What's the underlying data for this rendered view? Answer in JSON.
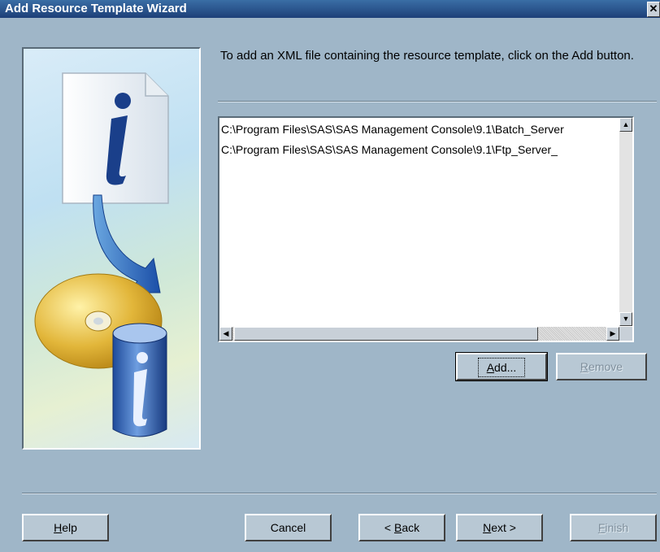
{
  "window": {
    "title": "Add Resource Template Wizard",
    "close_glyph": "✕"
  },
  "instruction": "To add an XML file containing the resource template, click on the Add button.",
  "files": [
    "C:\\Program Files\\SAS\\SAS Management Console\\9.1\\Batch_Server",
    "C:\\Program Files\\SAS\\SAS Management Console\\9.1\\Ftp_Server_"
  ],
  "buttons": {
    "add": {
      "pre": "",
      "key": "A",
      "post": "dd..."
    },
    "remove": {
      "pre": "",
      "key": "R",
      "post": "emove",
      "enabled": false
    },
    "help": {
      "pre": "",
      "key": "H",
      "post": "elp"
    },
    "cancel": "Cancel",
    "back": {
      "pre": "< ",
      "key": "B",
      "post": "ack"
    },
    "next": {
      "pre": "",
      "key": "N",
      "post": "ext >"
    },
    "finish": {
      "pre": "",
      "key": "F",
      "post": "inish",
      "enabled": false
    }
  },
  "icons": {
    "left": [
      "document-info-icon",
      "arrow-icon",
      "cd-disc-icon",
      "database-info-icon"
    ]
  },
  "colors": {
    "titlebar": "#1d3f78",
    "dialog_bg": "#9fb6c8",
    "button_face": "#b8c8d4"
  }
}
